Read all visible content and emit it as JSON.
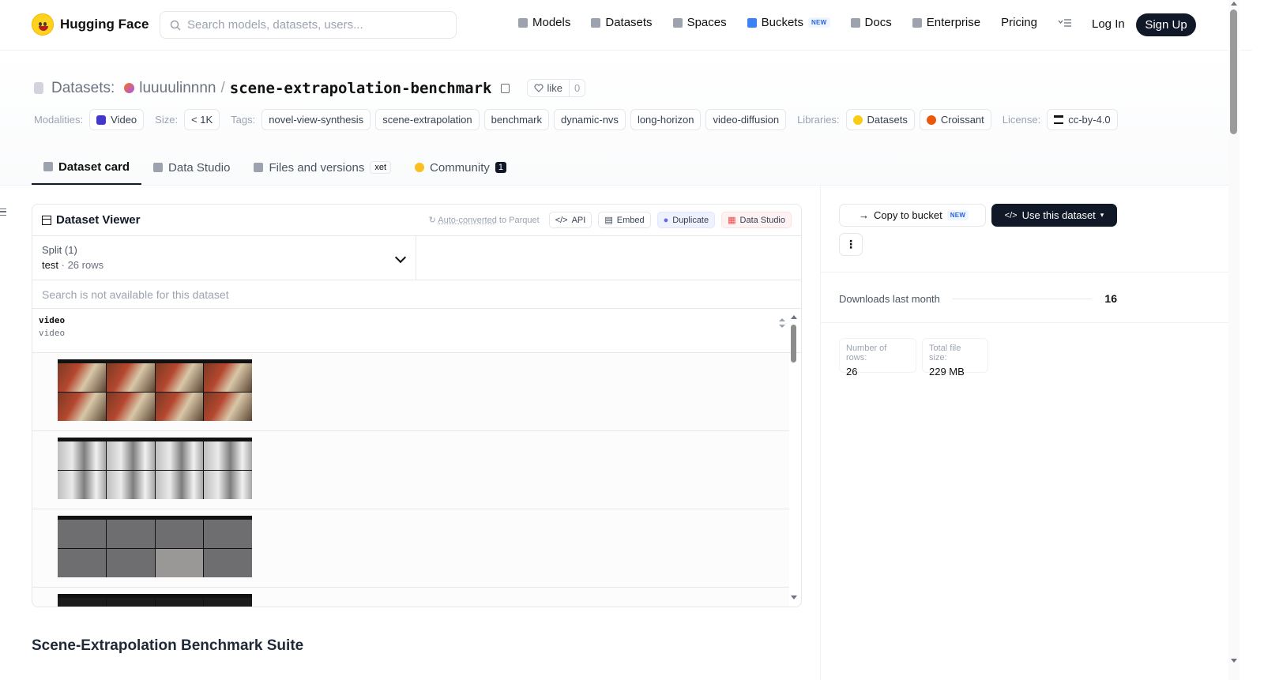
{
  "nav": {
    "brand": "Hugging Face",
    "search_placeholder": "Search models, datasets, users...",
    "links": [
      "Models",
      "Datasets",
      "Spaces",
      "Buckets",
      "Docs",
      "Enterprise",
      "Pricing"
    ],
    "new_badge": "NEW",
    "login": "Log In",
    "signup": "Sign Up"
  },
  "header": {
    "section_label": "Datasets:",
    "owner": "luuuulinnnn",
    "separator": "/",
    "repo": "scene-extrapolation-benchmark",
    "like_label": "like",
    "like_count": "0"
  },
  "meta": {
    "modalities_label": "Modalities:",
    "modality": "Video",
    "size_label": "Size:",
    "size": "< 1K",
    "tags_label": "Tags:",
    "tags": [
      "novel-view-synthesis",
      "scene-extrapolation",
      "benchmark",
      "dynamic-nvs",
      "long-horizon",
      "video-diffusion"
    ],
    "libraries_label": "Libraries:",
    "libraries": [
      "Datasets",
      "Croissant"
    ],
    "license_label": "License:",
    "license": "cc-by-4.0"
  },
  "tabs": {
    "dataset_card": "Dataset card",
    "data_studio": "Data Studio",
    "files": "Files and versions",
    "xet": "xet",
    "community": "Community",
    "community_count": "1"
  },
  "viewer": {
    "title": "Dataset Viewer",
    "auto_converted_link": "Auto-converted",
    "auto_converted_suffix": "to Parquet",
    "api": "API",
    "embed": "Embed",
    "duplicate": "Duplicate",
    "data_studio": "Data Studio",
    "split_label": "Split (1)",
    "split_name": "test",
    "split_dot": "·",
    "split_rows": "26 rows",
    "search_na": "Search is not available for this dataset",
    "column_name": "video",
    "column_type": "video"
  },
  "card": {
    "section_title": "Scene-Extrapolation Benchmark Suite"
  },
  "right_panel": {
    "copy_bucket": "Copy to bucket",
    "new_badge": "NEW",
    "use_dataset": "Use this dataset",
    "downloads_label": "Downloads last month",
    "downloads_value": "16",
    "rows_label": "Number of rows:",
    "rows_value": "26",
    "filesize_label": "Total file size:",
    "filesize_value": "229 MB"
  }
}
